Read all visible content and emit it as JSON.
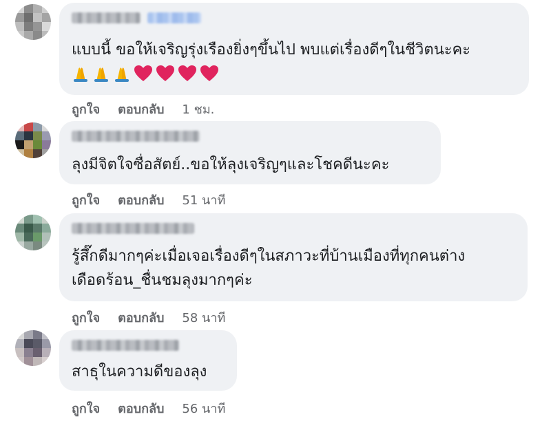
{
  "colors": {
    "bubble": "#eff1f4",
    "text": "#1c1e21",
    "meta": "#65676b",
    "heart": "#e0245e",
    "pray": "#f5b400"
  },
  "comments": [
    {
      "text_lines": [
        "แบบนี้ ขอให้เจริญรุ่งเรืองยิ่งๆขึ้นไป พบแต่เรื่องดีๆในชีวิตนะคะ"
      ],
      "emojis": [
        "folded-hands",
        "folded-hands",
        "folded-hands",
        "red-heart",
        "red-heart",
        "red-heart",
        "red-heart"
      ],
      "like_label": "ถูกใจ",
      "reply_label": "ตอบกลับ",
      "time": "1 ชม."
    },
    {
      "text_lines": [
        "ลุงมีจิตใจซื่อสัตย์..ขอให้ลุงเจริญๆและโชคดีนะคะ"
      ],
      "like_label": "ถูกใจ",
      "reply_label": "ตอบกลับ",
      "time": "51 นาที"
    },
    {
      "text_lines": [
        "รู้สึ๊กดีมากๆค่ะเมื่อเจอเรื่องดีๆในสภาวะที่บ้านเมืองที่ทุกคนต่าง",
        "เดือดร้อน_ชื่นชมลุงมากๆค่ะ"
      ],
      "like_label": "ถูกใจ",
      "reply_label": "ตอบกลับ",
      "time": "58 นาที"
    },
    {
      "text_lines": [
        "สาธุในความดีของลุง"
      ],
      "like_label": "ถูกใจ",
      "reply_label": "ตอบกลับ",
      "time": "56 นาที"
    }
  ]
}
